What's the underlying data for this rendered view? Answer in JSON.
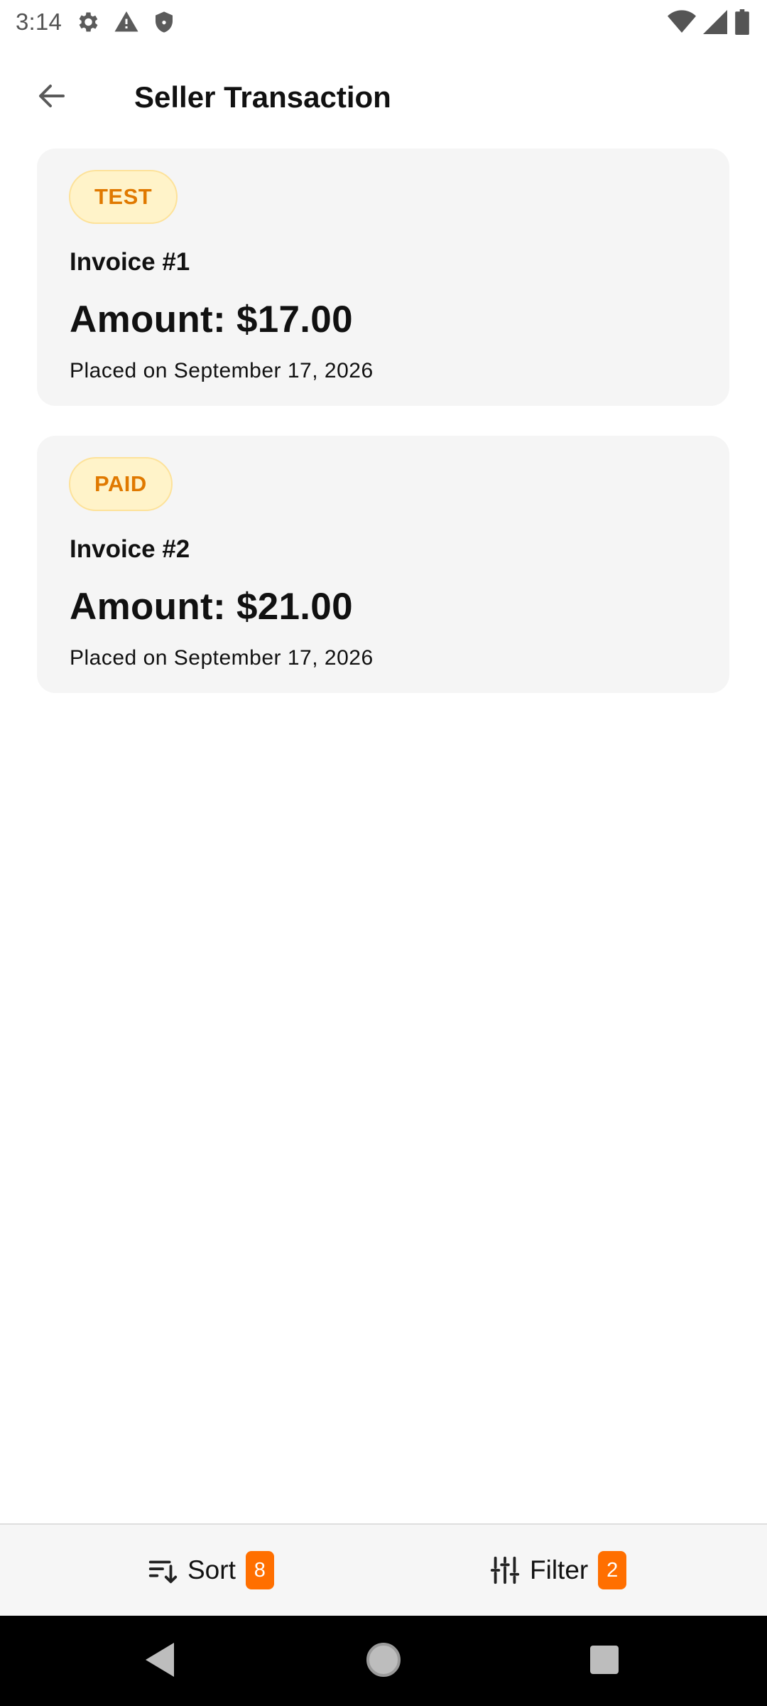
{
  "status_bar": {
    "time": "3:14",
    "left_icons": [
      "gear-icon",
      "warning-icon",
      "shield-icon"
    ],
    "right_icons": [
      "wifi-icon",
      "cellular-signal-icon",
      "battery-icon"
    ]
  },
  "header": {
    "title": "Seller Transaction",
    "back_icon": "arrow-left-icon"
  },
  "invoices": [
    {
      "status": "TEST",
      "invoice_label": "Invoice #1",
      "amount_text": "Amount: $17.00",
      "placed_text": "Placed on September 17, 2026"
    },
    {
      "status": "PAID",
      "invoice_label": "Invoice #2",
      "amount_text": "Amount: $21.00",
      "placed_text": "Placed on September 17, 2026"
    }
  ],
  "bottom_bar": {
    "sort": {
      "label": "Sort",
      "count": "8",
      "icon": "sort-icon"
    },
    "filter": {
      "label": "Filter",
      "count": "2",
      "icon": "filter-sliders-icon"
    }
  },
  "colors": {
    "accent": "#ff6f00",
    "badge_bg": "#fff3c9",
    "badge_text": "#e07900",
    "card_bg": "#f5f5f5"
  }
}
